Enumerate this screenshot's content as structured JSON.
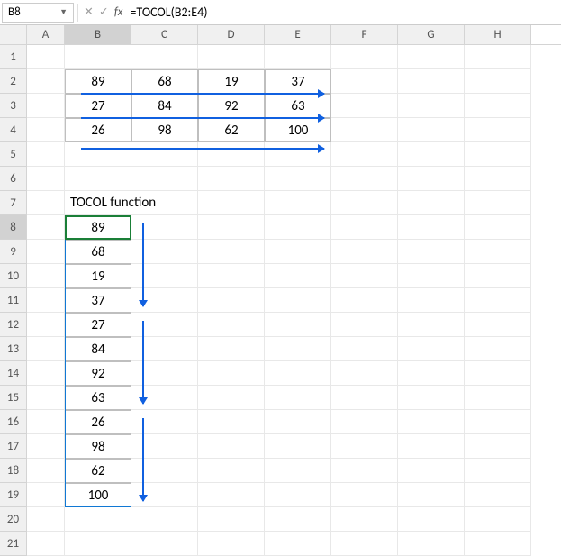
{
  "formula_bar": {
    "cell_ref": "B8",
    "formula": "=TOCOL(B2:E4)"
  },
  "columns": [
    "A",
    "B",
    "C",
    "D",
    "E",
    "F",
    "G",
    "H"
  ],
  "rows": [
    "1",
    "2",
    "3",
    "4",
    "5",
    "6",
    "7",
    "8",
    "9",
    "10",
    "11",
    "12",
    "13",
    "14",
    "15",
    "16",
    "17",
    "18",
    "19",
    "20",
    "21"
  ],
  "source_table": {
    "r1": {
      "B": "89",
      "C": "68",
      "D": "19",
      "E": "37"
    },
    "r2": {
      "B": "27",
      "C": "84",
      "D": "92",
      "E": "63"
    },
    "r3": {
      "B": "26",
      "C": "98",
      "D": "62",
      "E": "100"
    }
  },
  "heading": "TOCOL function",
  "result_col": [
    "89",
    "68",
    "19",
    "37",
    "27",
    "84",
    "92",
    "63",
    "26",
    "98",
    "62",
    "100"
  ],
  "chart_data": {
    "type": "table",
    "title": "TOCOL function",
    "source": [
      [
        89,
        68,
        19,
        37
      ],
      [
        27,
        84,
        92,
        63
      ],
      [
        26,
        98,
        62,
        100
      ]
    ],
    "result": [
      89,
      68,
      19,
      37,
      27,
      84,
      92,
      63,
      26,
      98,
      62,
      100
    ]
  }
}
